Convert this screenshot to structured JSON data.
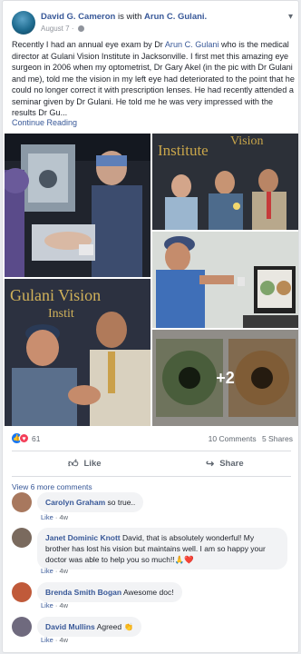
{
  "post": {
    "author": "David G. Cameron",
    "with_text": "is with",
    "tagged": "Arun C. Gulani.",
    "date": "August 7",
    "date_sep": "·",
    "body_lines": [
      "Recently I had an annual eye exam by Dr ",
      "Arun C. Gulani",
      " who is the medical director at Gulani Vision Institute in Jacksonville. I first met this amazing eye surgeon in 2006 when my optometrist, Dr Gary Akel (in the pic with Dr Gulani and me), told me the vision in my left eye had deteriorated to the point that he could no longer correct it with prescription lenses. He had recently attended a seminar given by Dr Gulani. He told me he was very impressed with the results Dr Gu..."
    ],
    "continue": "Continue Reading",
    "photos_more": "+2",
    "reactions_count": "61",
    "comments_count": "10 Comments",
    "shares_count": "5 Shares",
    "like_label": "Like",
    "share_label": "Share"
  },
  "comments_section": {
    "view_more": "View 6 more comments",
    "like_label": "Like",
    "dot": "·",
    "items": [
      {
        "name": "Carolyn Graham",
        "text": "so true..",
        "time": "4w"
      },
      {
        "name": "Janet Dominic Knott",
        "text": "David, that is absolutely wonderful! My brother has lost his vision but maintains well. I am so happy your doctor was able to help you so much!!🙏❤️",
        "time": "4w"
      },
      {
        "name": "Brenda Smith Bogan",
        "text": "Awesome doc!",
        "time": "4w"
      },
      {
        "name": "David Mullins",
        "text": "Agreed 👏",
        "time": "4w"
      }
    ]
  },
  "colors": {
    "link": "#385898",
    "like_blue": "#1877f2",
    "love_red": "#f33e58"
  }
}
